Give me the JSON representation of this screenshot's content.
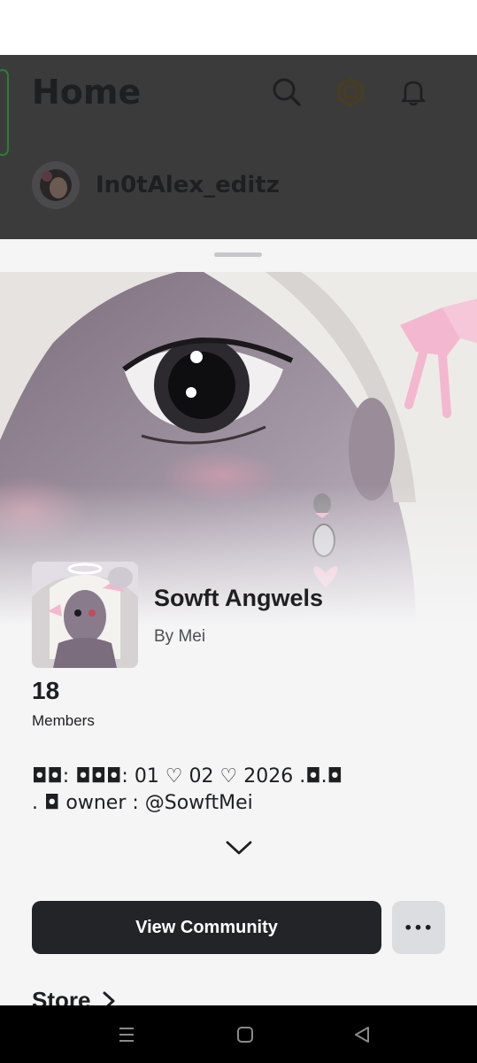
{
  "header": {
    "title": "Home",
    "icons": [
      "search-icon",
      "robux-icon",
      "bell-icon"
    ]
  },
  "user": {
    "username": "In0tAlex_editz"
  },
  "community": {
    "name": "Sowft Angwels",
    "by": "By Mei",
    "members_count": "18",
    "members_label": "Members",
    "description_line1": "◘◘: ◘◘◘: 01 ♡ 02 ♡ 2026  .◘.◘",
    "description_line2": "   . ◘ owner : @SowftMei"
  },
  "actions": {
    "view_label": "View Community",
    "more_label": "•••"
  },
  "store": {
    "label": "Store"
  },
  "colors": {
    "primary_button": "#232428",
    "secondary_button": "#dcdde0",
    "sheet_bg": "#f5f5f6",
    "dim_overlay": "#3b3b3c"
  }
}
